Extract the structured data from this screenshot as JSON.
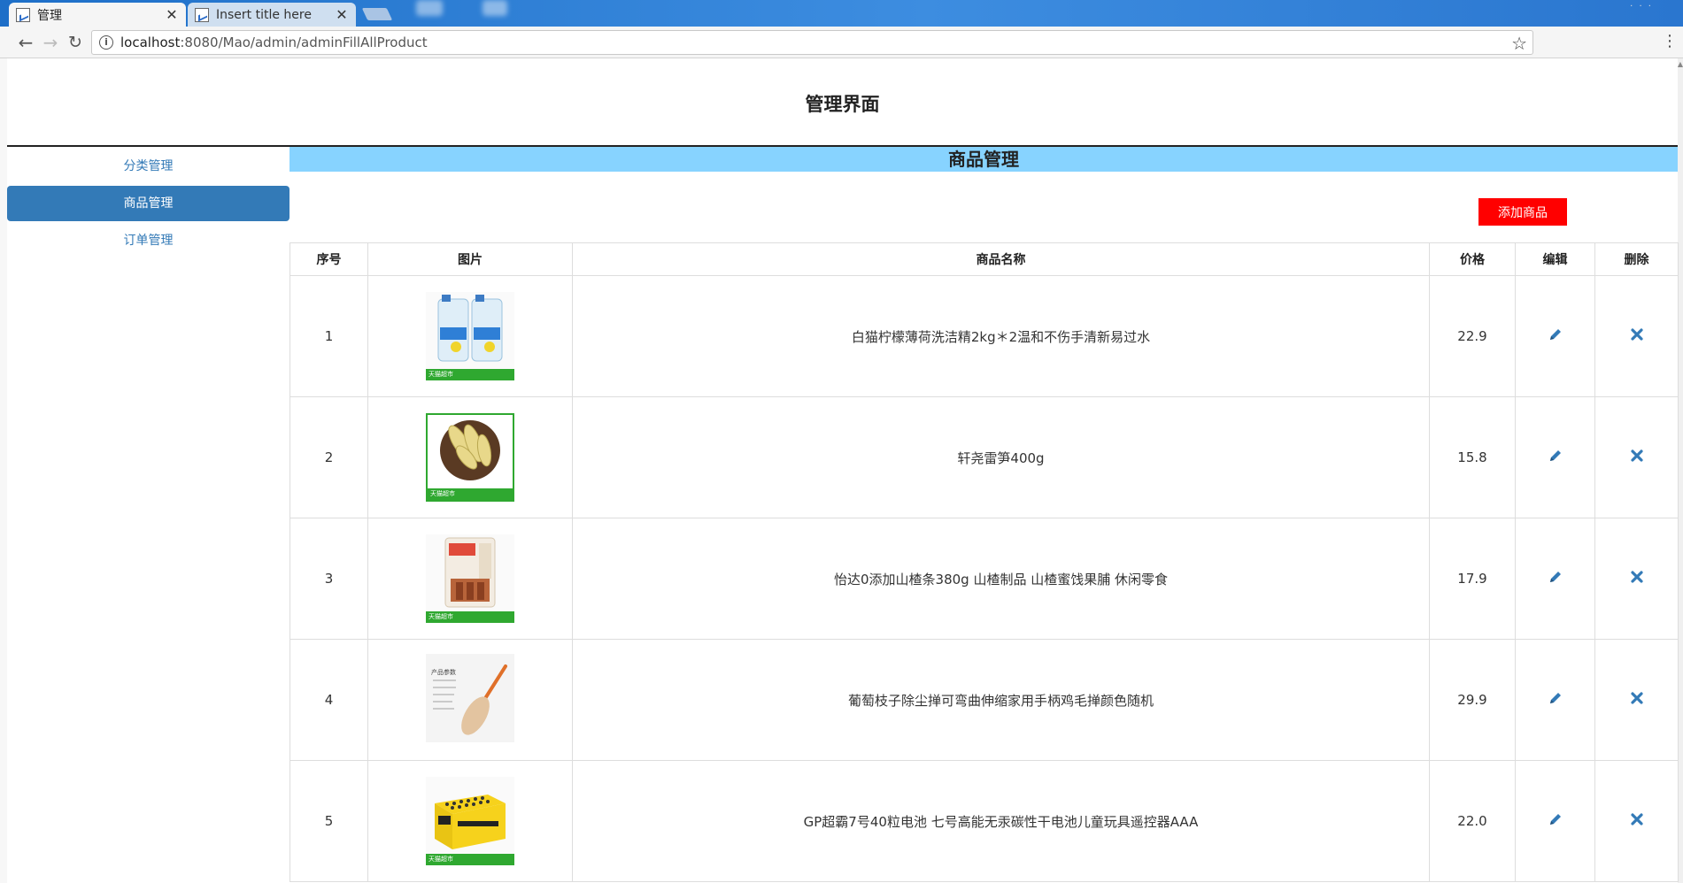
{
  "browser": {
    "tabs": [
      {
        "title": "管理",
        "active": true
      },
      {
        "title": "Insert title here",
        "active": false
      }
    ],
    "url_host": "localhost",
    "url_rest": ":8080/Mao/admin/adminFillAllProduct"
  },
  "page": {
    "title": "管理界面"
  },
  "sidebar": {
    "items": [
      {
        "label": "分类管理",
        "active": false
      },
      {
        "label": "商品管理",
        "active": true
      },
      {
        "label": "订单管理",
        "active": false
      }
    ]
  },
  "main": {
    "section_title": "商品管理",
    "add_button": "添加商品",
    "columns": [
      "序号",
      "图片",
      "商品名称",
      "价格",
      "编辑",
      "删除"
    ],
    "rows": [
      {
        "id": "1",
        "name": "白猫柠檬薄荷洗洁精2kg＊2温和不伤手清新易过水",
        "price": "22.9",
        "image_text": "天猫超市"
      },
      {
        "id": "2",
        "name": "轩尧雷笋400g",
        "price": "15.8",
        "image_text": "天猫超市"
      },
      {
        "id": "3",
        "name": "怡达0添加山楂条380g 山楂制品 山楂蜜饯果脯 休闲零食",
        "price": "17.9",
        "image_text": "天猫超市"
      },
      {
        "id": "4",
        "name": "葡萄枝子除尘掸可弯曲伸缩家用手柄鸡毛掸颜色随机",
        "price": "29.9",
        "image_text": "产品参数"
      },
      {
        "id": "5",
        "name": "GP超霸7号40粒电池 七号高能无汞碳性干电池儿童玩具遥控器AAA",
        "price": "22.0",
        "image_text": "天猫超市"
      }
    ]
  },
  "colors": {
    "accent": "#337ab7",
    "section_bar": "#87d3ff",
    "add_button": "#ff0000"
  }
}
